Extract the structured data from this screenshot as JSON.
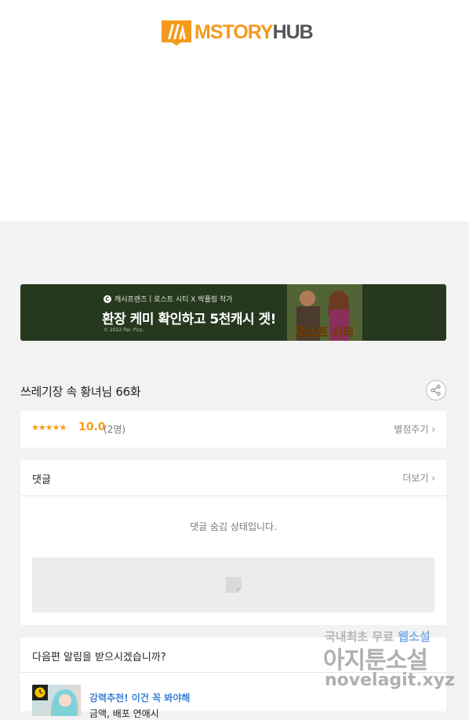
{
  "header": {
    "logo_text_m": "MSTORY",
    "logo_text_h": "HUB"
  },
  "banner": {
    "brand": "캐시프렌즈",
    "tagline": "로스트 시티 X 박플럼 작가",
    "headline": "환장 케미 확인하고 5천캐시 겟!",
    "copyright": "© 2022 Par. Pics.",
    "poster_title": "로스트 시티"
  },
  "episode": {
    "title": "쓰레기장 속 황녀님 66화"
  },
  "rating": {
    "stars": "★★★★★",
    "score": "10.0",
    "count": "(2명)",
    "rate_label": "별점주기 ›"
  },
  "comments": {
    "title": "댓글",
    "more_label": "더보기 ›",
    "hidden_message": "댓글 숨김 상태입니다."
  },
  "next_alert": {
    "title": "다음편 알림을 받으시겠습니까?",
    "recommend_label": "강력추천! 이건 꼭 봐야해",
    "recommend_sub": "금액, 배포 연애시"
  },
  "watermark": {
    "line1a": "국내최초 무료 ",
    "line1b": "웹소설",
    "line2": "아지툰소설",
    "line3": "novelagit.xyz"
  },
  "colors": {
    "accent": "#f39c1a",
    "banner_bg": "#26391f",
    "link_blue": "#3d7fd6"
  }
}
